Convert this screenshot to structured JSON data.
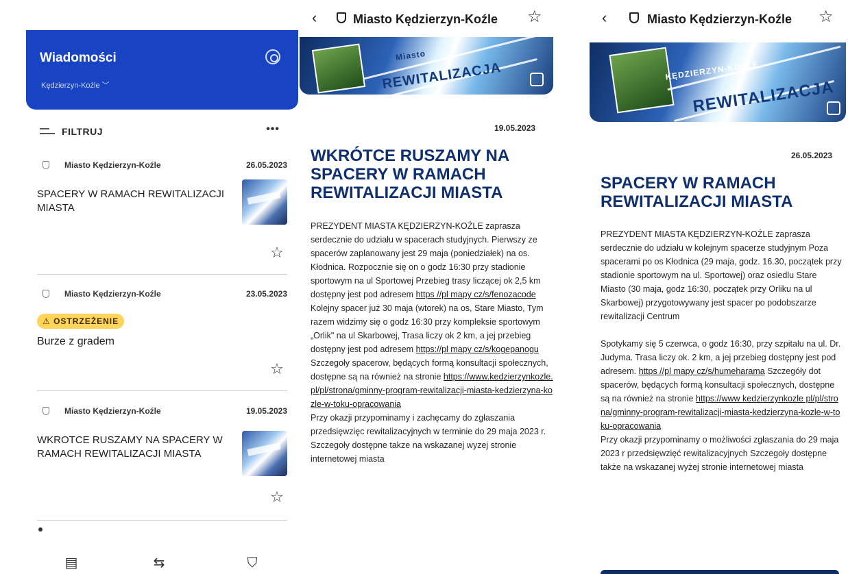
{
  "list": {
    "title": "Wiadomości",
    "city_selector": "Kędzierzyn-Koźle ﹀",
    "filter_label": "FILTRUJ",
    "more": "•••",
    "items": [
      {
        "source": "Miasto Kędzierzyn-Koźle",
        "date": "26.05.2023",
        "title": "SPACERY W RAMACH REWITALIZACJI MIASTA"
      },
      {
        "source": "Miasto Kędzierzyn-Koźle",
        "date": "23.05.2023",
        "badge": "⚠ OSTRZEŻENIE",
        "title": "Burze z gradem"
      },
      {
        "source": "Miasto Kędzierzyn-Koźle",
        "date": "19.05.2023",
        "title": "WKROTCE RUSZAMY NA SPACERY W RAMACH REWITALIZACJI MIASTA"
      }
    ],
    "tab_icons": [
      "news-icon",
      "route-icon",
      "shield-icon"
    ]
  },
  "article_a": {
    "back": "‹",
    "source": "Miasto Kędzierzyn-Koźle",
    "star": "☆",
    "banner_text": "REWITALIZACJA",
    "banner_text_small": "Miasto",
    "date": "19.05.2023",
    "title": "WKRÓTCE RUSZAMY NA SPACERY W RAMACH REWITALIZACJI MIASTA",
    "p1": "PREZYDENT MIASTA KĘDZIERZYN-KOŹLE zaprasza serdecznie do udziału w spacerach studyjnych. Pierwszy ze spacerów zaplanowany jest 29 maja (poniedziałek) na os. Kłodnica. Rozpocznie się on o godz 16:30 przy stadionie sportowym na ul Sportowej Przebieg trasy liczącej ok 2,5 km dostępny jest pod adresem",
    "link1": "https //pl mapy cz/s/fenozacode",
    "p2": " Kolejny spacer już 30 maja (wtorek) na os, Stare Miasto, Tym razem widzimy się o godz 16:30 przy kompleksie sportowym „Orlik\" na ul Skarbowej, Trasa liczy ok 2 km, a jej przebieg dostępny jest pod adresem",
    "link2": "https://pl mapy cz/s/kogepanogu",
    "p3": "Szczegoły spacerow, będących formą konsultacji społecznych, dostępne są na również na stronie",
    "link3": "https://www.kedzierzynkozle.pl/pl/strona/gminny-program-rewitalizacji-miasta-kedzierzyna-kozle-w-toku-opracowania",
    "p4": "Przy okazji przypominamy i zachęcamy do zgłaszania przedsięwzięc rewitalizacyjnych w terminie do 29 maja 2023 r. Szczegoły dostępne takze na wskazanej wyzej stronie internetowej miasta"
  },
  "article_b": {
    "back": "‹",
    "source": "Miasto Kędzierzyn-Koźle",
    "star": "☆",
    "banner_text": "REWITALIZACJA",
    "banner_text_small": "KĘDZIERZYN-KOŹLE",
    "date": "26.05.2023",
    "title": "SPACERY W RAMACH REWITALIZACJI MIASTA",
    "p1": "PREZYDENT MIASTA KĘDZIERZYN-KOŹLE zaprasza serdecznie do udziału w kolejnym spacerze studyjnym Poza spacerami po os Kłodnica (29 maja, godz. 16.30, początek przy stadionie sportowym na ul. Sportowej) oraz osiedlu Stare Miasto (30 maja, godz 16:30, początek przy Orliku na ul Skarbowej) przygotowywany jest spacer po podobszarze rewitalizacji Centrum",
    "p2": "Spotykamy się 5 czerwca, o godz 16:30, przy szpitalu na ul. Dr. Judyma. Trasa liczy ok. 2 km, a jej przebieg dostępny jest pod adresem.",
    "link1": "https //pl mapy cz/s/humeharama",
    "p3": " Szczegóły dot spacerów, będących formą konsultacji społecznych, dostępne są na również na stronie",
    "link2": "https://www kedzierzynkozle pl/pl/strona/gminny-program-rewitalizacji-miasta-kedzierzyna-kozle-w-toku-opracowania",
    "p4": "Przy okazji przypominamy o możliwości zgłaszania do 29 maja 2023 r przedsięwzięć rewitalizacyjnych Szczegoły dostępne także na wskazanej wyżej stronie internetowej miasta"
  }
}
